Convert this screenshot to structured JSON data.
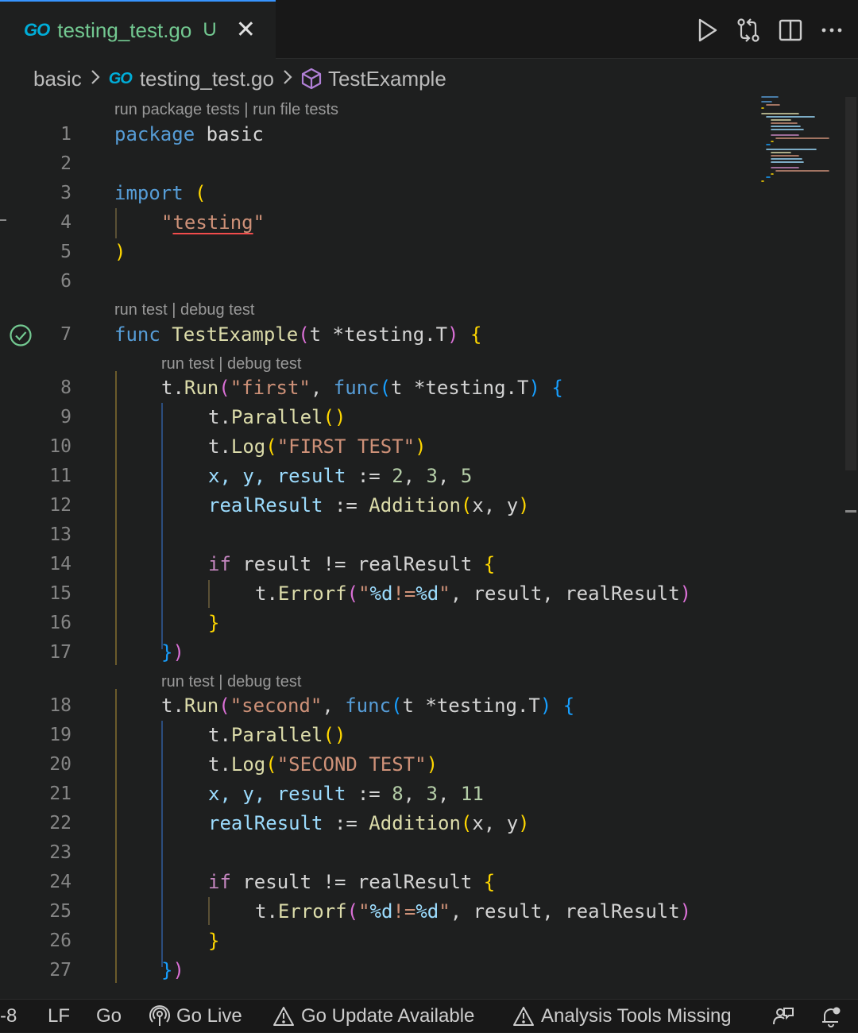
{
  "tab": {
    "badge": "GO",
    "filename": "testing_test.go",
    "status": "U",
    "close_glyph": "✕"
  },
  "actions": [
    "run-icon",
    "compare-changes-icon",
    "split-editor-icon",
    "more-actions-icon"
  ],
  "breadcrumb": {
    "folder": "basic",
    "file_badge": "GO",
    "file": "testing_test.go",
    "symbol": "TestExample"
  },
  "codelens": {
    "package": "run package tests | run file tests",
    "test": "run test | debug test"
  },
  "lines": [
    "1",
    "2",
    "3",
    "4",
    "5",
    "6",
    "7",
    "8",
    "9",
    "10",
    "11",
    "12",
    "13",
    "14",
    "15",
    "16",
    "17",
    "18",
    "19",
    "20",
    "21",
    "22",
    "23",
    "24",
    "25",
    "26",
    "27"
  ],
  "code": {
    "l1": {
      "kw": "package",
      "name": " basic"
    },
    "l3": {
      "kw": "import",
      "paren": " ("
    },
    "l4": {
      "q1": "\"",
      "pkg": "testing",
      "q2": "\""
    },
    "l5": {
      "paren": ")"
    },
    "l7": {
      "kw": "func",
      "name": " TestExample",
      "p1": "(",
      "param": "t ",
      "star": "*",
      "type": "testing.T",
      "p2": ")",
      "brace": " {"
    },
    "l8": {
      "recv": "t.",
      "fn": "Run",
      "p1": "(",
      "str": "\"first\"",
      "comma": ", ",
      "kw": "func",
      "p2": "(",
      "param": "t ",
      "star": "*",
      "type": "testing.T",
      "p3": ")",
      "brace": " {"
    },
    "l9": {
      "recv": "t.",
      "fn": "Parallel",
      "p": "()"
    },
    "l10": {
      "recv": "t.",
      "fn": "Log",
      "p1": "(",
      "str": "\"FIRST TEST\"",
      "p2": ")"
    },
    "l11": {
      "vars": "x, y, result",
      "op": " := ",
      "n1": "2",
      "c1": ", ",
      "n2": "3",
      "c2": ", ",
      "n3": "5"
    },
    "l12": {
      "var": "realResult",
      "op": " := ",
      "fn": "Addition",
      "p1": "(",
      "args": "x, y",
      "p2": ")"
    },
    "l14": {
      "kw": "if",
      "cond": " result != realResult",
      "brace": " {"
    },
    "l15": {
      "recv": "t.",
      "fn": "Errorf",
      "p1": "(",
      "q1": "\"",
      "f1": "%d",
      "mid": "!=",
      "f2": "%d",
      "q2": "\"",
      "args": ", result, realResult",
      "p2": ")"
    },
    "l16": {
      "brace": "}"
    },
    "l17": {
      "b1": "}",
      "b2": ")"
    },
    "l18": {
      "recv": "t.",
      "fn": "Run",
      "p1": "(",
      "str": "\"second\"",
      "comma": ", ",
      "kw": "func",
      "p2": "(",
      "param": "t ",
      "star": "*",
      "type": "testing.T",
      "p3": ")",
      "brace": " {"
    },
    "l19": {
      "recv": "t.",
      "fn": "Parallel",
      "p": "()"
    },
    "l20": {
      "recv": "t.",
      "fn": "Log",
      "p1": "(",
      "str": "\"SECOND TEST\"",
      "p2": ")"
    },
    "l21": {
      "vars": "x, y, result",
      "op": " := ",
      "n1": "8",
      "c1": ", ",
      "n2": "3",
      "c2": ", ",
      "n3": "11"
    },
    "l22": {
      "var": "realResult",
      "op": " := ",
      "fn": "Addition",
      "p1": "(",
      "args": "x, y",
      "p2": ")"
    },
    "l24": {
      "kw": "if",
      "cond": " result != realResult",
      "brace": " {"
    },
    "l25": {
      "recv": "t.",
      "fn": "Errorf",
      "p1": "(",
      "q1": "\"",
      "f1": "%d",
      "mid": "!=",
      "f2": "%d",
      "q2": "\"",
      "args": ", result, realResult",
      "p2": ")"
    },
    "l26": {
      "brace": "}"
    },
    "l27": {
      "b1": "}",
      "b2": ")"
    }
  },
  "status": {
    "position": "-8",
    "eol": "LF",
    "language": "Go",
    "golive": "Go Live",
    "update": "Go Update Available",
    "tools": "Analysis Tools Missing"
  },
  "colors": {
    "accent": "#3794ff",
    "go_blue": "#00add8",
    "untracked_green": "#73c991",
    "test_pass": "#73c991"
  }
}
